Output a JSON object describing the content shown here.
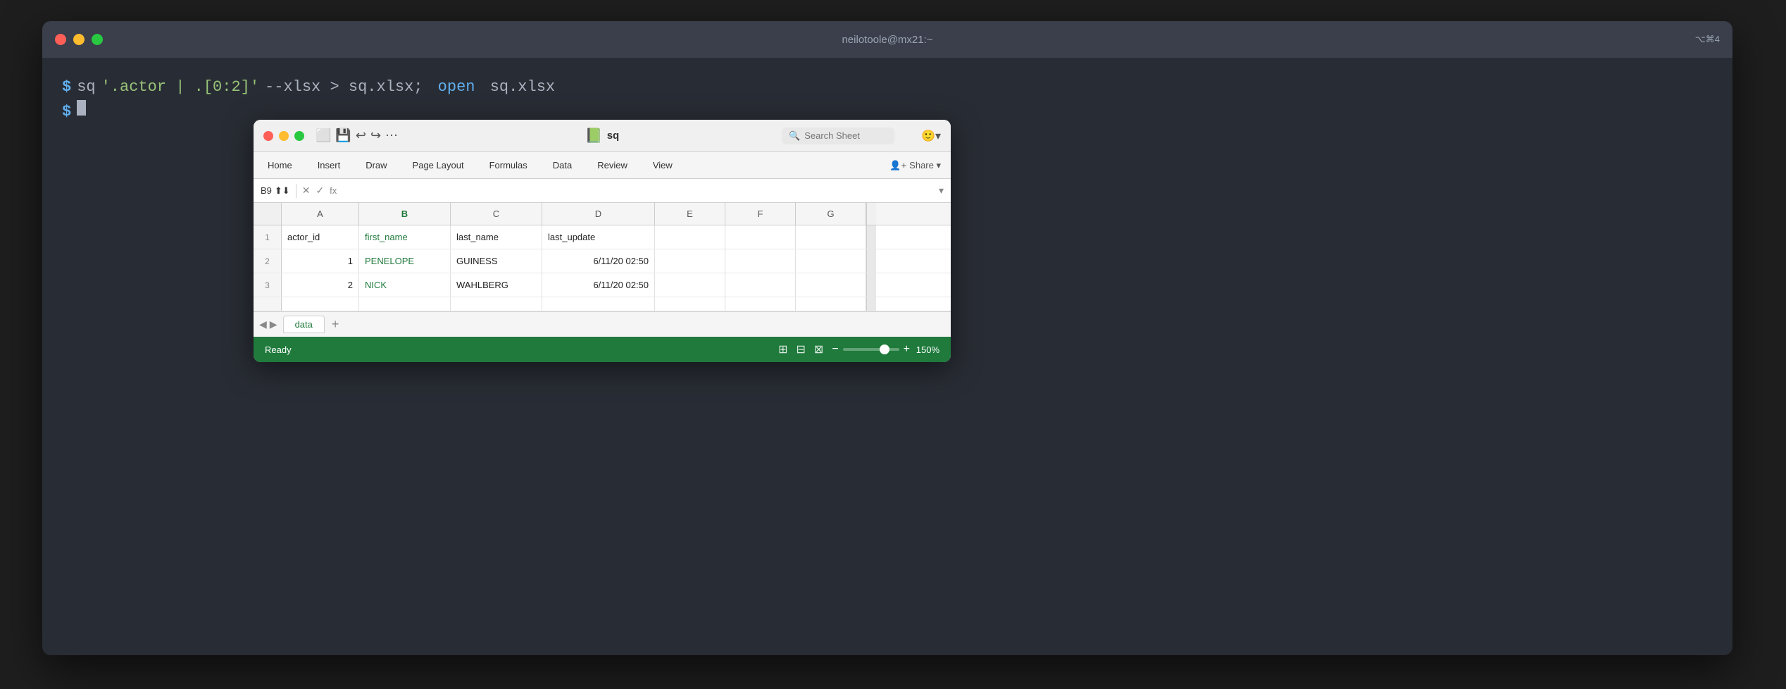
{
  "terminal": {
    "title": "neilotoole@mx21:~",
    "keyboard_shortcut": "⌥⌘4",
    "line1": {
      "prompt": "$",
      "command": "sq '.actor | .[0:2]' --xlsx > sq.xlsx;",
      "open_cmd": "open",
      "file": "sq.xlsx"
    },
    "line2": {
      "prompt": "$"
    }
  },
  "excel": {
    "title": "sq",
    "icon": "📊",
    "search_placeholder": "Search Sheet",
    "ribbon": {
      "items": [
        "Home",
        "Insert",
        "Draw",
        "Page Layout",
        "Formulas",
        "Data",
        "Review",
        "View"
      ]
    },
    "formula_bar": {
      "cell_ref": "B9",
      "fx_label": "fx"
    },
    "columns": {
      "headers": [
        "A",
        "B",
        "C",
        "D",
        "E",
        "F",
        "G"
      ],
      "selected": "B"
    },
    "rows": [
      {
        "row_num": "1",
        "cells": [
          "actor_id",
          "first_name",
          "last_name",
          "last_update",
          "",
          "",
          ""
        ]
      },
      {
        "row_num": "2",
        "cells": [
          "1",
          "PENELOPE",
          "GUINESS",
          "6/11/20 02:50",
          "",
          "",
          ""
        ]
      },
      {
        "row_num": "3",
        "cells": [
          "2",
          "NICK",
          "WAHLBERG",
          "6/11/20 02:50",
          "",
          "",
          ""
        ]
      }
    ],
    "sheet_tab": "data",
    "add_tab_label": "+",
    "status": {
      "ready": "Ready",
      "zoom": "150%"
    }
  }
}
